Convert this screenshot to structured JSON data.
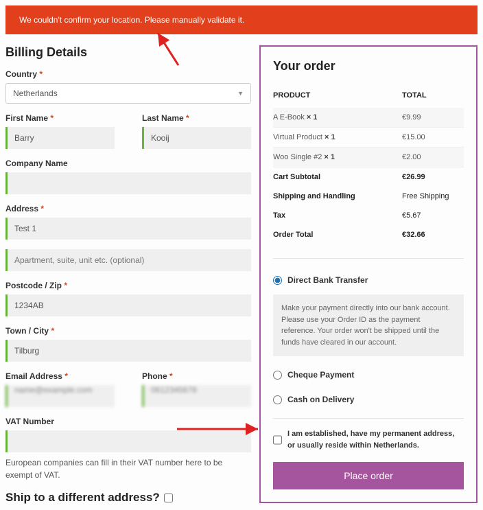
{
  "error": "We couldn't confirm your location. Please manually validate it.",
  "billing": {
    "heading": "Billing Details",
    "country_label": "Country",
    "country_value": "Netherlands",
    "first_name_label": "First Name",
    "first_name_value": "Barry",
    "last_name_label": "Last Name",
    "last_name_value": "Kooij",
    "company_label": "Company Name",
    "company_value": "",
    "address_label": "Address",
    "address1_value": "Test 1",
    "address2_placeholder": "Apartment, suite, unit etc. (optional)",
    "postcode_label": "Postcode / Zip",
    "postcode_value": "1234AB",
    "town_label": "Town / City",
    "town_value": "Tilburg",
    "email_label": "Email Address",
    "email_value": "name@example.com",
    "phone_label": "Phone",
    "phone_value": "0612345678",
    "vat_label": "VAT Number",
    "vat_value": "",
    "vat_help": "European companies can fill in their VAT number here to be exempt of VAT.",
    "ship_diff": "Ship to a different address?"
  },
  "order": {
    "heading": "Your order",
    "col_product": "PRODUCT",
    "col_total": "TOTAL",
    "items": [
      {
        "name": "A E-Book",
        "qty": "× 1",
        "total": "€9.99"
      },
      {
        "name": "Virtual Product",
        "qty": "× 1",
        "total": "€15.00"
      },
      {
        "name": "Woo Single #2",
        "qty": "× 1",
        "total": "€2.00"
      }
    ],
    "rows": [
      {
        "label": "Cart Subtotal",
        "value": "€26.99"
      },
      {
        "label": "Shipping and Handling",
        "value": "Free Shipping"
      },
      {
        "label": "Tax",
        "value": "€5.67"
      },
      {
        "label": "Order Total",
        "value": "€32.66"
      }
    ]
  },
  "payment": {
    "bank": "Direct Bank Transfer",
    "bank_desc": "Make your payment directly into our bank account. Please use your Order ID as the payment reference. Your order won't be shipped until the funds have cleared in our account.",
    "cheque": "Cheque Payment",
    "cod": "Cash on Delivery",
    "confirm": "I am established, have my permanent address, or usually reside within Netherlands.",
    "place": "Place order"
  }
}
